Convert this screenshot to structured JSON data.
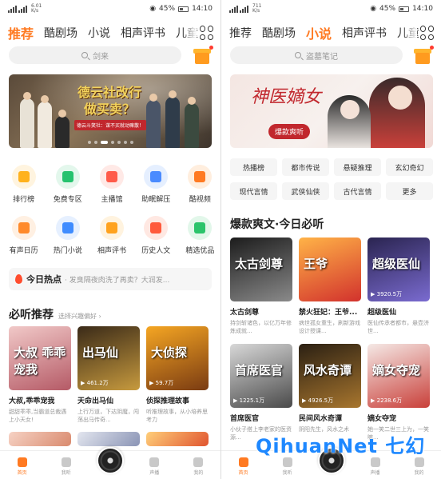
{
  "left": {
    "status": {
      "speed": "6.01",
      "speed_unit": "K/s",
      "battery": "45%",
      "time": "14:10"
    },
    "tabs": [
      {
        "label": "推荐",
        "active": true
      },
      {
        "label": "酷剧场"
      },
      {
        "label": "小说"
      },
      {
        "label": "相声评书"
      },
      {
        "label": "儿童"
      }
    ],
    "search_placeholder": "剑来",
    "banner": {
      "title": "德云社改行做买卖？",
      "subtitle": "德云斗笑社：谋不买就动嘛散！"
    },
    "icons_row1": [
      {
        "label": "排行榜",
        "icon": "ranking-icon",
        "color": "#ffb21e",
        "bg": "#fff4df"
      },
      {
        "label": "免费专区",
        "icon": "free-tag-icon",
        "color": "#26c26e",
        "bg": "#e3f7ec"
      },
      {
        "label": "主播馆",
        "icon": "anchor-icon",
        "color": "#ff5b4a",
        "bg": "#ffe9e6"
      },
      {
        "label": "助眠解压",
        "icon": "moon-icon",
        "color": "#4a8bff",
        "bg": "#e5efff"
      },
      {
        "label": "酷视频",
        "icon": "video-icon",
        "color": "#ff7a22",
        "bg": "#ffeede"
      }
    ],
    "icons_row2": [
      {
        "label": "有声日历",
        "icon": "calendar-icon",
        "color": "#ff8a2b",
        "bg": "#fff0e2"
      },
      {
        "label": "热门小说",
        "icon": "book-icon",
        "color": "#3f8cff",
        "bg": "#e6f0ff"
      },
      {
        "label": "相声评书",
        "icon": "fan-icon",
        "color": "#ffa21e",
        "bg": "#fff3df"
      },
      {
        "label": "历史人文",
        "icon": "history-icon",
        "color": "#ff5a3c",
        "bg": "#ffe8e2"
      },
      {
        "label": "精选优品",
        "icon": "diamond-icon",
        "color": "#2bc46b",
        "bg": "#e2f7ea"
      }
    ],
    "hot": {
      "label": "今日热点",
      "text": "· 发臭隔夜肉洗了再卖？大润发..."
    },
    "section": {
      "title": "必听推荐",
      "sub": "选择兴趣偏好 ›"
    },
    "books": [
      {
        "title": "大叔,乖乖宠我",
        "desc": "甜甜乖乖,当霸道总裁遇上小天女!",
        "plays": "",
        "cover": "大叔\n乖乖宠我",
        "c1": "#f1c9c8",
        "c2": "#b55a66"
      },
      {
        "title": "天命出马仙",
        "desc": "上行万道，下达阴魔，闯荡出马传奇...",
        "plays": "461.2万",
        "cover": "出马仙",
        "c1": "#3a2a18",
        "c2": "#c79a3e"
      },
      {
        "title": "侦探推理故事",
        "desc": "听推理故事，从小培养思考力",
        "plays": "59.7万",
        "cover": "大侦探",
        "c1": "#f5a623",
        "c2": "#7a3b12"
      }
    ],
    "nav": [
      {
        "label": "首页",
        "active": true
      },
      {
        "label": "我听"
      },
      {
        "label": ""
      },
      {
        "label": "声播"
      },
      {
        "label": "我的"
      }
    ]
  },
  "right": {
    "status": {
      "speed": "711",
      "speed_unit": "K/s",
      "battery": "45%",
      "time": "14:10"
    },
    "tabs": [
      {
        "label": "推荐"
      },
      {
        "label": "酷剧场"
      },
      {
        "label": "小说",
        "active": true
      },
      {
        "label": "相声评书"
      },
      {
        "label": "儿童"
      }
    ],
    "search_placeholder": "盗墓笔记",
    "banner": {
      "title": "神医嫡女",
      "subtitle": "爆款爽听"
    },
    "chips": [
      "热播榜",
      "都市传说",
      "悬疑推理",
      "玄幻奇幻",
      "现代言情",
      "武侠仙侠",
      "古代言情",
      "更多"
    ],
    "section": {
      "title": "爆款爽文·今日必听"
    },
    "books_row1": [
      {
        "title": "太古剑尊",
        "desc": "持剑斩诸色，以亿万年修炼成就...",
        "plays": "",
        "cover": "太古剑尊",
        "c1": "#1c1c1c",
        "c2": "#8a8a8a"
      },
      {
        "title": "禁火狂妃：王爷...",
        "desc": "病世孤女重生，刷新游戏设计授课...",
        "plays": "",
        "cover": "王爷",
        "c1": "#ffb347",
        "c2": "#d2322d"
      },
      {
        "title": "超级医仙",
        "desc": "医仙传承者都市，悬壶济世...",
        "plays": "3920.5万",
        "cover": "超级医仙",
        "c1": "#2a2450",
        "c2": "#7a6bd0"
      }
    ],
    "books_row2": [
      {
        "title": "首席医官",
        "desc": "小伙子搭上李老家的医资源...",
        "plays": "1225.1万",
        "cover": "首席医官",
        "c1": "#d8d8d8",
        "c2": "#4a4a4a"
      },
      {
        "title": "民间风水奇谭",
        "desc": "阴阳先生，风水之术",
        "plays": "4926.5万",
        "cover": "风水奇谭",
        "c1": "#2b2013",
        "c2": "#a8762e"
      },
      {
        "title": "嫡女夺宠",
        "desc": "她一笑二世三上为，一笑嘛...",
        "plays": "2238.6万",
        "cover": "嫡女夺宠",
        "c1": "#f5e9e6",
        "c2": "#c9403a"
      }
    ],
    "nav": [
      {
        "label": "首页",
        "active": true
      },
      {
        "label": "我听"
      },
      {
        "label": ""
      },
      {
        "label": "声播"
      },
      {
        "label": "我的"
      }
    ],
    "watermark": "QihuanNet 七幻"
  }
}
